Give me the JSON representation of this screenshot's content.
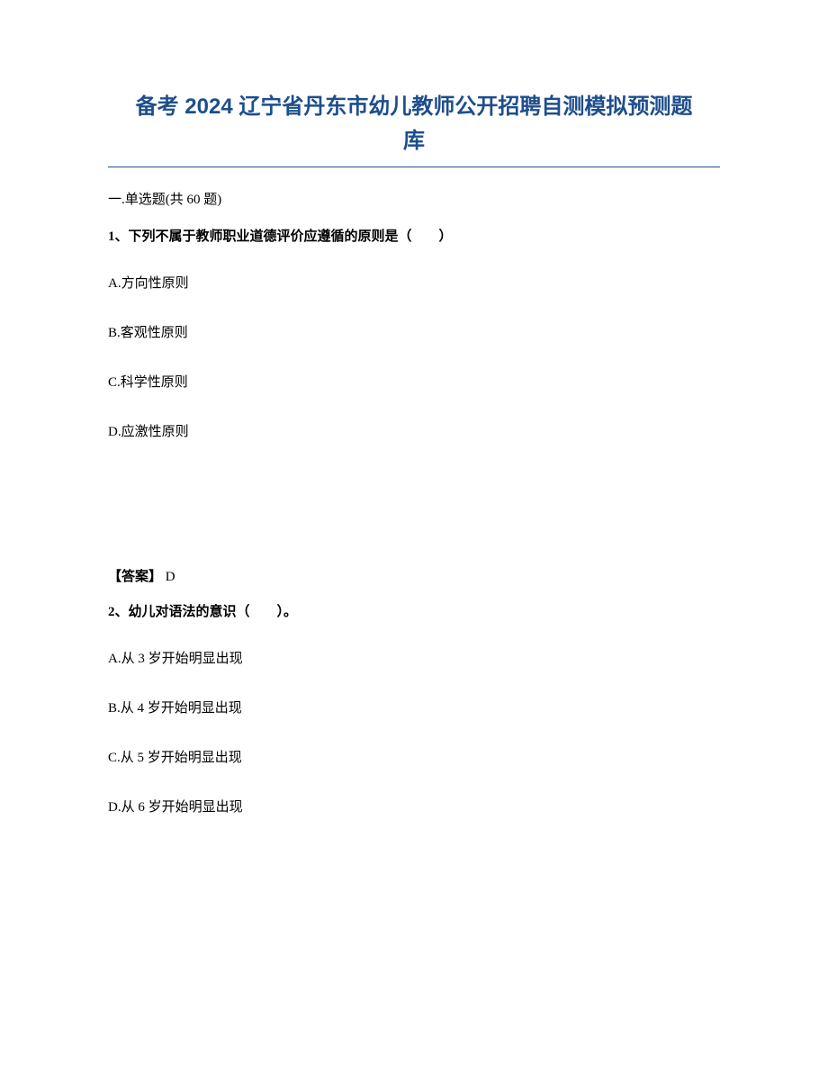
{
  "title_line1": "备考 2024 辽宁省丹东市幼儿教师公开招聘自测模拟预测题",
  "title_line2": "库",
  "section_heading": "一.单选题(共 60 题)",
  "q1": {
    "stem": "1、下列不属于教师职业道德评价应遵循的原则是（　　）",
    "optA": "A.方向性原则",
    "optB": "B.客观性原则",
    "optC": "C.科学性原则",
    "optD": "D.应激性原则",
    "answer_label": "【答案】",
    "answer_value": " D"
  },
  "q2": {
    "stem": "2、幼儿对语法的意识（　　）。",
    "optA": "A.从 3 岁开始明显出现",
    "optB": "B.从 4 岁开始明显出现",
    "optC": "C.从 5 岁开始明显出现",
    "optD": "D.从 6 岁开始明显出现"
  }
}
